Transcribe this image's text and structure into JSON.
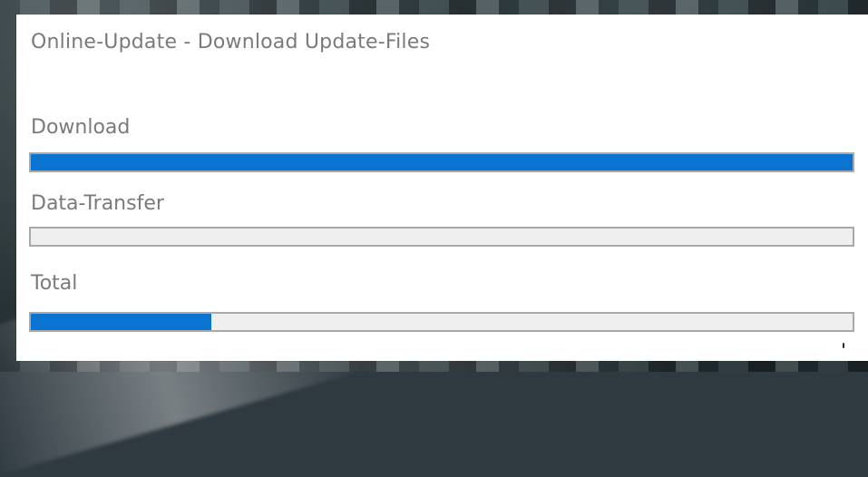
{
  "window": {
    "title": "Online-Update - Download Update-Files"
  },
  "progress": {
    "download": {
      "label": "Download",
      "value_percent": 100
    },
    "data_transfer": {
      "label": "Data-Transfer",
      "value_percent": 0
    },
    "total": {
      "label": "Total",
      "value_percent": 22
    }
  },
  "colors": {
    "text_gray": "#7a7a7a",
    "progress_fill": "#0b74d2",
    "progress_track": "#efefef",
    "progress_border": "#a9a9a9"
  }
}
